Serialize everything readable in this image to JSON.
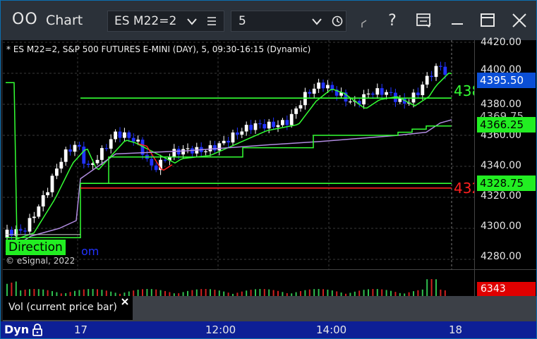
{
  "window": {
    "logo_glyph": "OO",
    "title": "Chart",
    "symbol_value": "ES M22=2",
    "interval_value": "5"
  },
  "chart": {
    "header": "* ES M22=2, S&P 500 FUTURES E-MINI (DAY), 5, 09:30-16:15 (Dynamic)",
    "copyright": "© eSignal, 2022",
    "direction_label": "Direction",
    "direction_suffix": "om",
    "upper_level_text": "438",
    "lower_level_text": "432"
  },
  "price_scale": {
    "ticks": [
      "4420.00",
      "4400.00",
      "4380.00",
      "4360.00",
      "4340.00",
      "4320.00",
      "4300.00",
      "4280.00"
    ],
    "labels": {
      "last": "4395.50",
      "mid_hidden": "4369.75",
      "middle": "4366.25",
      "lower": "4328.75"
    }
  },
  "volume": {
    "value": "6343",
    "study_label": "Vol (current price bar)"
  },
  "time_axis": {
    "mode_label": "Dyn",
    "labels": [
      "17",
      "12:00",
      "14:00",
      "18"
    ]
  },
  "colors": {
    "up_candle": "#ffffff",
    "down_candle": "#2233ff",
    "green_line": "#33ff33",
    "red_line": "#ff2020",
    "purple_line": "#b08ce0",
    "last_price_bg": "#0b4fd6",
    "green_label_bg": "#22ee22",
    "red_label_bg": "#e00000"
  },
  "icons": [
    "chevron-down-icon",
    "list-icon",
    "clock-icon",
    "help-icon",
    "template-icon",
    "minimize-icon",
    "maximize-icon",
    "close-icon",
    "lock-icon",
    "close-study-icon"
  ]
}
